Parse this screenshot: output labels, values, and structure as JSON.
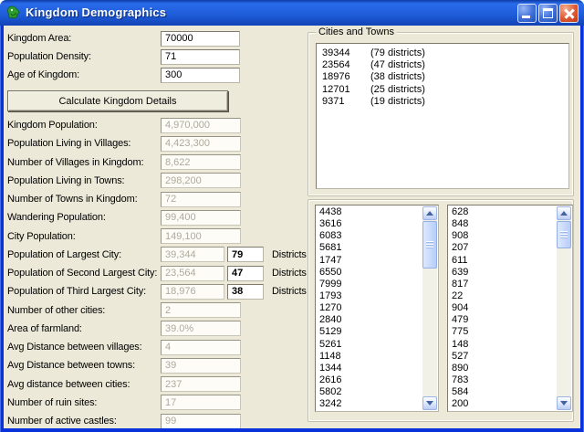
{
  "window": {
    "title": "Kingdom Demographics",
    "icon": "green-creature-app-icon",
    "controls": {
      "minimize": "minimize",
      "maximize": "maximize",
      "close": "close"
    }
  },
  "colors": {
    "titlebar_blue": "#1E5CD9",
    "window_border_blue": "#0831D9",
    "client_background": "#ECE9D8",
    "disabled_text": "#ADAA9C",
    "close_button_red": "#DD5A32",
    "scrollbar_blue": "#B7CDF9"
  },
  "inputs": [
    {
      "label": "Kingdom Area:",
      "value": "70000"
    },
    {
      "label": "Population Density:",
      "value": "71"
    },
    {
      "label": "Age of Kingdom:",
      "value": "300"
    }
  ],
  "calculate_button": "Calculate Kingdom Details",
  "results": [
    {
      "label": "Kingdom Population:",
      "value": "4,970,000"
    },
    {
      "label": "Population Living in Villages:",
      "value": "4,423,300"
    },
    {
      "label": "Number of Villages in Kingdom:",
      "value": "8,622"
    },
    {
      "label": "Population Living in Towns:",
      "value": "298,200"
    },
    {
      "label": "Number of Towns in Kingdom:",
      "value": "72"
    },
    {
      "label": "Wandering Population:",
      "value": "99,400"
    },
    {
      "label": "City Population:",
      "value": "149,100"
    },
    {
      "label": "Population of Largest City:",
      "value": "39,344",
      "districts": "79",
      "districts_label": "Districts"
    },
    {
      "label": "Population of Second Largest City:",
      "value": "23,564",
      "districts": "47",
      "districts_label": "Districts"
    },
    {
      "label": "Population of Third Largest City:",
      "value": "18,976",
      "districts": "38",
      "districts_label": "Districts"
    },
    {
      "label": "Number of other cities:",
      "value": "2"
    },
    {
      "label": "Area of farmland:",
      "value": "39.0%"
    },
    {
      "label": "Avg Distance between villages:",
      "value": "4"
    },
    {
      "label": "Avg Distance between towns:",
      "value": "39"
    },
    {
      "label": "Avg distance between cities:",
      "value": "237"
    },
    {
      "label": "Number of ruin sites:",
      "value": "17"
    },
    {
      "label": "Number of active castles:",
      "value": "99"
    }
  ],
  "cities_group": {
    "title": "Cities and Towns",
    "items": [
      {
        "population": "39344",
        "districts": "(79 districts)"
      },
      {
        "population": "23564",
        "districts": "(47 districts)"
      },
      {
        "population": "18976",
        "districts": "(38 districts)"
      },
      {
        "population": "12701",
        "districts": "(25 districts)"
      },
      {
        "population": "9371",
        "districts": "(19 districts)"
      }
    ]
  },
  "left_list": [
    "4438",
    "3616",
    "6083",
    "5681",
    "1747",
    "6550",
    "7999",
    "1793",
    "1270",
    "2840",
    "5129",
    "5261",
    "1148",
    "1344",
    "2616",
    "5802",
    "3242"
  ],
  "right_list": [
    "628",
    "848",
    "908",
    "207",
    "611",
    "639",
    "817",
    "22",
    "904",
    "479",
    "775",
    "148",
    "527",
    "890",
    "783",
    "584",
    "200"
  ]
}
